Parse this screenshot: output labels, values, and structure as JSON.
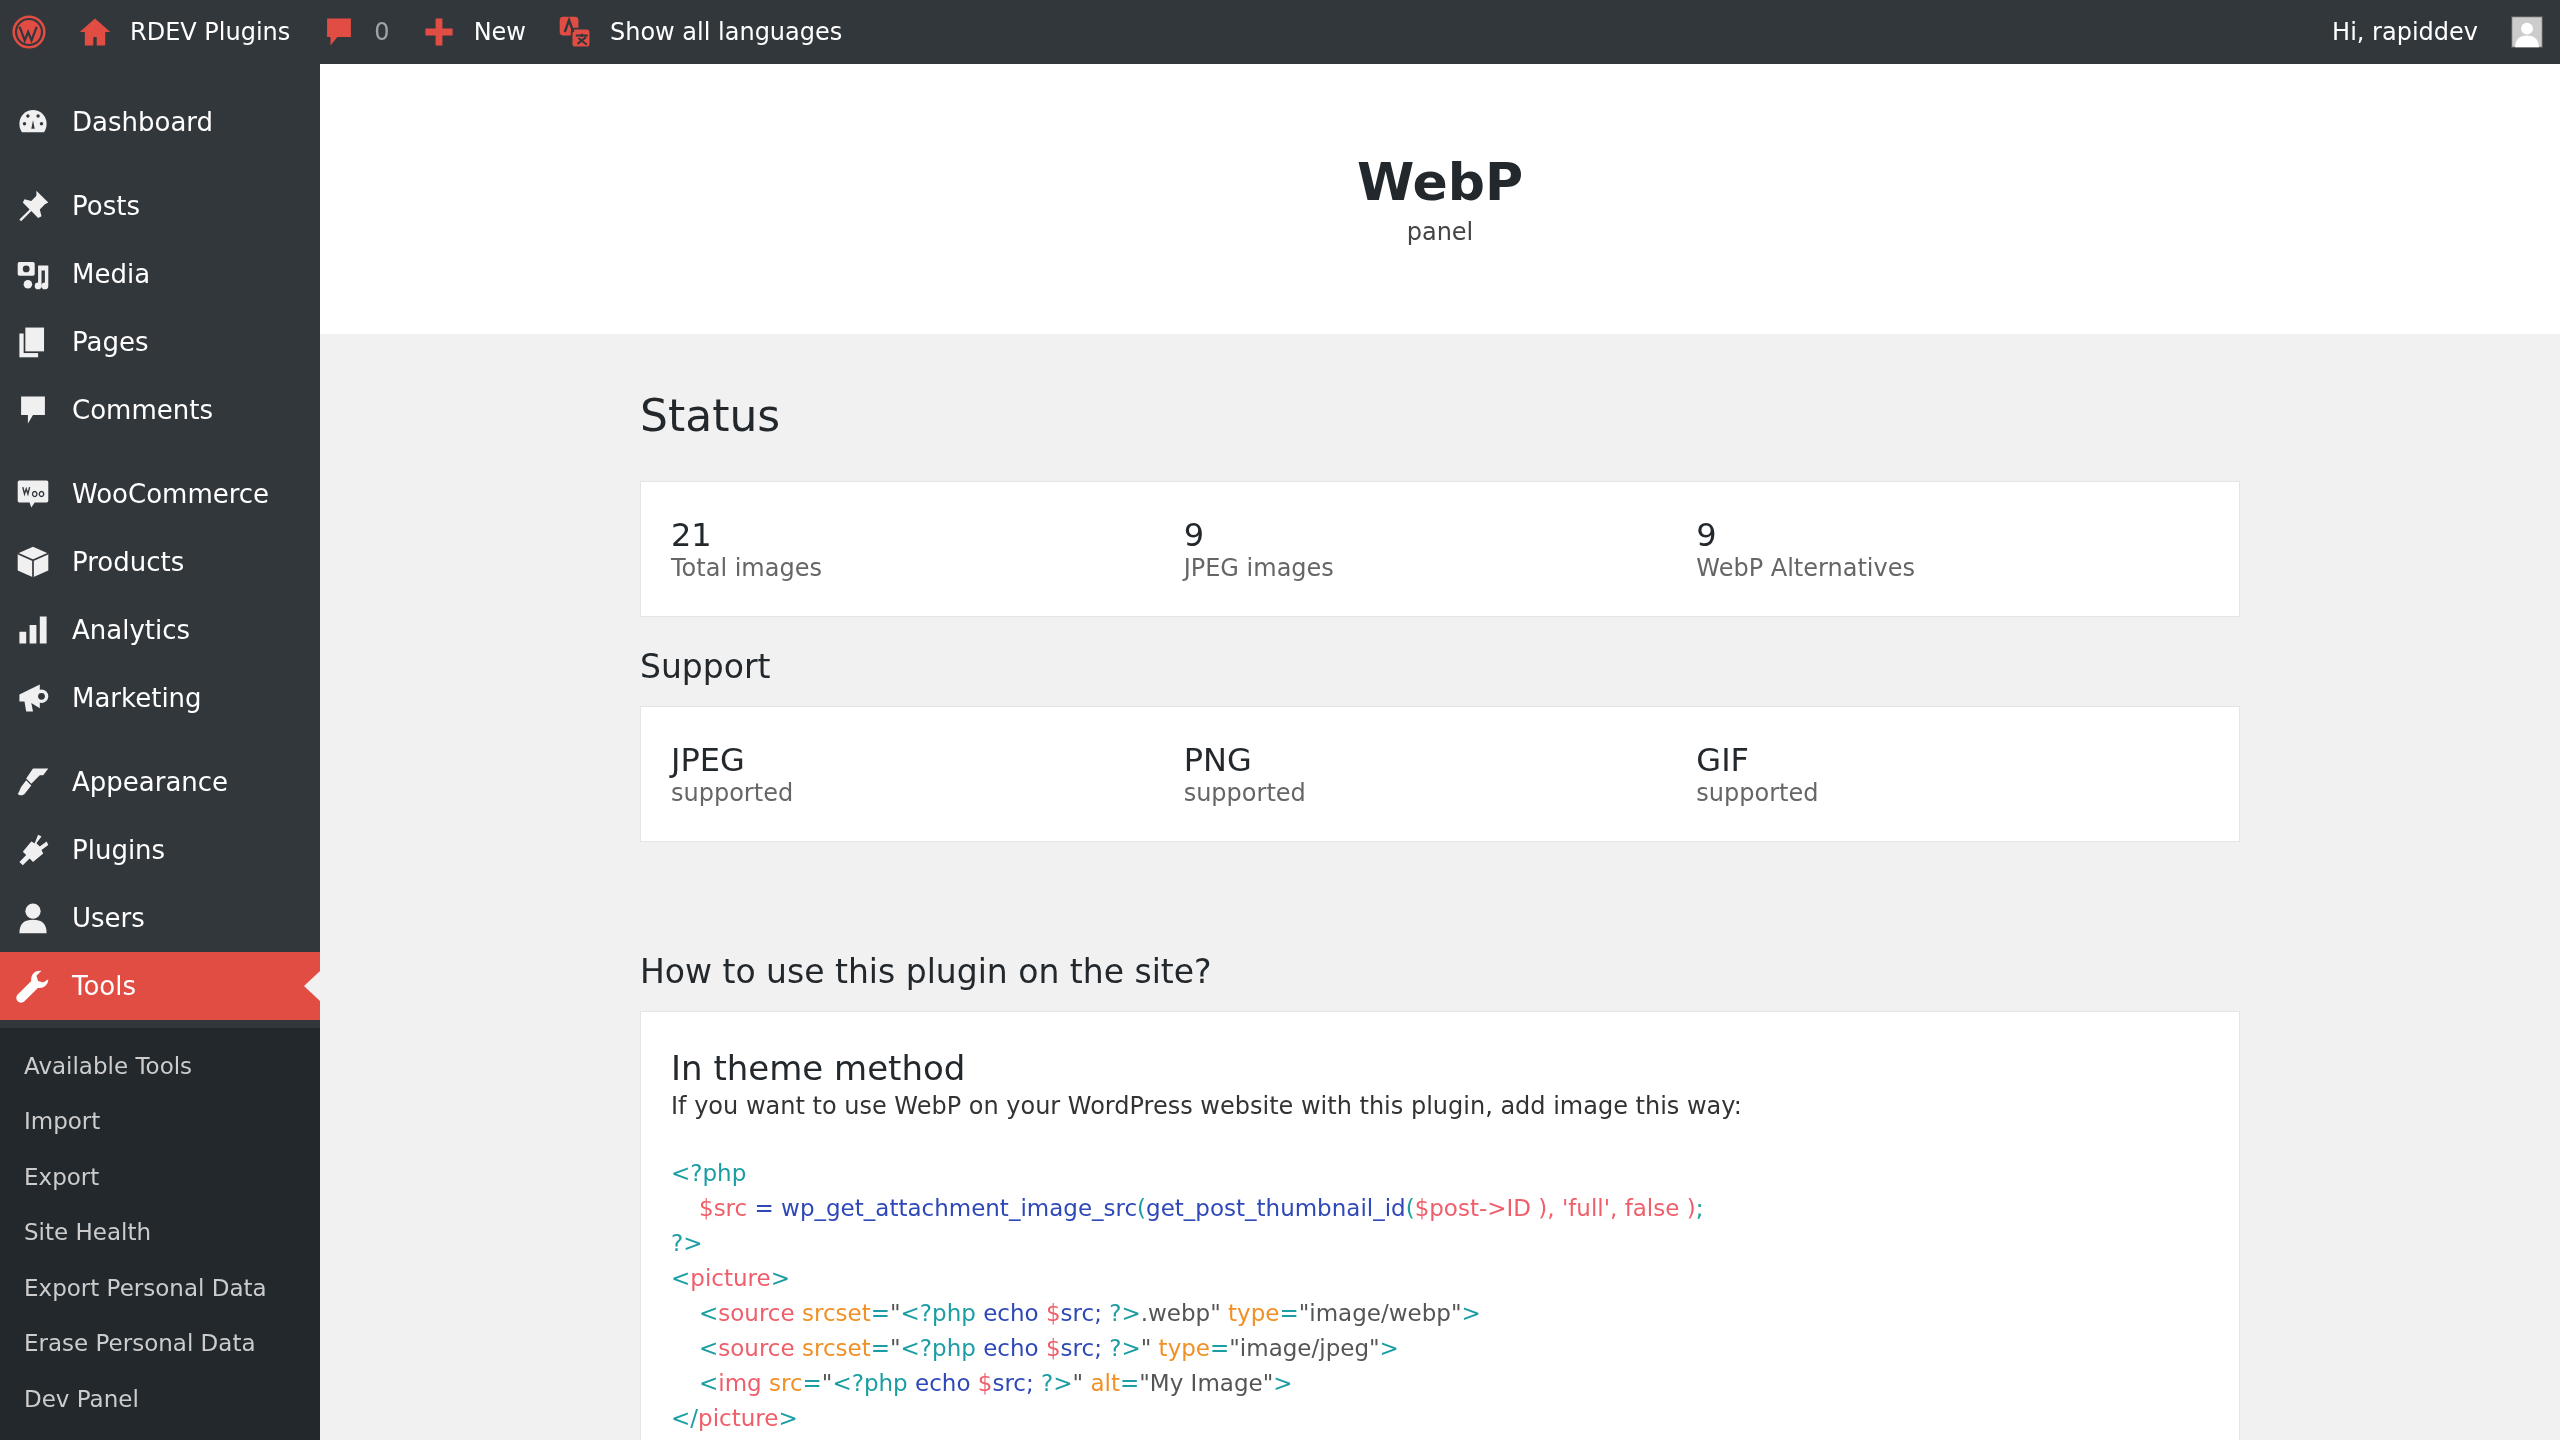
{
  "admin_bar": {
    "items": [
      {
        "label": "RDEV Plugins",
        "muted": false
      },
      {
        "label": "0",
        "muted": true
      },
      {
        "label": "New",
        "muted": false
      },
      {
        "label": "Show all languages",
        "muted": false
      }
    ],
    "greeting": "Hi, rapiddev"
  },
  "sidebar": {
    "groups": [
      [
        {
          "label": "Dashboard",
          "selected": false
        }
      ],
      [
        {
          "label": "Posts",
          "selected": false
        },
        {
          "label": "Media",
          "selected": false
        },
        {
          "label": "Pages",
          "selected": false
        },
        {
          "label": "Comments",
          "selected": false
        }
      ],
      [
        {
          "label": "WooCommerce",
          "selected": false
        },
        {
          "label": "Products",
          "selected": false
        },
        {
          "label": "Analytics",
          "selected": false
        },
        {
          "label": "Marketing",
          "selected": false
        }
      ],
      [
        {
          "label": "Appearance",
          "selected": false
        },
        {
          "label": "Plugins",
          "selected": false
        },
        {
          "label": "Users",
          "selected": false
        },
        {
          "label": "Tools",
          "selected": true
        }
      ]
    ],
    "submenu": [
      {
        "label": "Available Tools",
        "selected": false
      },
      {
        "label": "Import",
        "selected": false
      },
      {
        "label": "Export",
        "selected": false
      },
      {
        "label": "Site Health",
        "selected": false
      },
      {
        "label": "Export Personal Data",
        "selected": false
      },
      {
        "label": "Erase Personal Data",
        "selected": false
      },
      {
        "label": "Dev Panel",
        "selected": false
      }
    ]
  },
  "header": {
    "title": "WebP",
    "subtitle": "panel"
  },
  "status": {
    "heading": "Status",
    "stats": [
      {
        "value": "21",
        "label": "Total images"
      },
      {
        "value": "9",
        "label": "JPEG images"
      },
      {
        "value": "9",
        "label": "WebP Alternatives"
      }
    ]
  },
  "support": {
    "heading": "Support",
    "formats": [
      {
        "name": "JPEG",
        "status": "supported"
      },
      {
        "name": "PNG",
        "status": "supported"
      },
      {
        "name": "GIF",
        "status": "supported"
      }
    ]
  },
  "usage": {
    "heading": "How to use this plugin on the site?",
    "method_title": "In theme method",
    "description": "If you want to use WebP on your WordPress website with this plugin, add image this way:",
    "code_lines": [
      {
        "indented": false,
        "tokens": [
          {
            "text": "<?php",
            "kind": "punct"
          }
        ]
      },
      {
        "indented": true,
        "tokens": [
          {
            "text": "$src",
            "kind": "var"
          },
          {
            "text": " = wp_get_attachment_image_src",
            "kind": "func"
          },
          {
            "text": "(",
            "kind": "punct"
          },
          {
            "text": "get_post_thumbnail_id",
            "kind": "func"
          },
          {
            "text": "(",
            "kind": "punct"
          },
          {
            "text": "$post->ID ), 'full', false )",
            "kind": "var"
          },
          {
            "text": ";",
            "kind": "punct"
          }
        ]
      },
      {
        "indented": false,
        "tokens": [
          {
            "text": "?>",
            "kind": "punct"
          }
        ]
      },
      {
        "indented": false,
        "tokens": [
          {
            "text": "<",
            "kind": "punct"
          },
          {
            "text": "picture",
            "kind": "tag"
          },
          {
            "text": ">",
            "kind": "punct"
          }
        ]
      },
      {
        "indented": true,
        "tokens": [
          {
            "text": "<",
            "kind": "punct"
          },
          {
            "text": "source",
            "kind": "tag"
          },
          {
            "text": " srcset",
            "kind": "attr"
          },
          {
            "text": "=",
            "kind": "punct"
          },
          {
            "text": "\"",
            "kind": "str"
          },
          {
            "text": "<?php",
            "kind": "punct"
          },
          {
            "text": " echo ",
            "kind": "func"
          },
          {
            "text": "$",
            "kind": "var"
          },
          {
            "text": "src; ",
            "kind": "func"
          },
          {
            "text": "?>",
            "kind": "punct"
          },
          {
            "text": ".webp\"",
            "kind": "str"
          },
          {
            "text": " type",
            "kind": "attr"
          },
          {
            "text": "=",
            "kind": "punct"
          },
          {
            "text": "\"image/webp\"",
            "kind": "str"
          },
          {
            "text": ">",
            "kind": "punct"
          }
        ]
      },
      {
        "indented": true,
        "tokens": [
          {
            "text": "<",
            "kind": "punct"
          },
          {
            "text": "source",
            "kind": "tag"
          },
          {
            "text": " srcset",
            "kind": "attr"
          },
          {
            "text": "=",
            "kind": "punct"
          },
          {
            "text": "\"",
            "kind": "str"
          },
          {
            "text": "<?php",
            "kind": "punct"
          },
          {
            "text": " echo ",
            "kind": "func"
          },
          {
            "text": "$",
            "kind": "var"
          },
          {
            "text": "src; ",
            "kind": "func"
          },
          {
            "text": "?>",
            "kind": "punct"
          },
          {
            "text": "\"",
            "kind": "str"
          },
          {
            "text": " type",
            "kind": "attr"
          },
          {
            "text": "=",
            "kind": "punct"
          },
          {
            "text": "\"image/jpeg\"",
            "kind": "str"
          },
          {
            "text": ">",
            "kind": "punct"
          }
        ]
      },
      {
        "indented": true,
        "tokens": [
          {
            "text": "<",
            "kind": "punct"
          },
          {
            "text": "img",
            "kind": "tag"
          },
          {
            "text": " src",
            "kind": "attr"
          },
          {
            "text": "=",
            "kind": "punct"
          },
          {
            "text": "\"",
            "kind": "str"
          },
          {
            "text": "<?php",
            "kind": "punct"
          },
          {
            "text": " echo ",
            "kind": "func"
          },
          {
            "text": "$",
            "kind": "var"
          },
          {
            "text": "src; ",
            "kind": "func"
          },
          {
            "text": "?>",
            "kind": "punct"
          },
          {
            "text": "\"",
            "kind": "str"
          },
          {
            "text": " alt",
            "kind": "attr"
          },
          {
            "text": "=",
            "kind": "punct"
          },
          {
            "text": "\"My Image\"",
            "kind": "str"
          },
          {
            "text": ">",
            "kind": "punct"
          }
        ]
      },
      {
        "indented": false,
        "tokens": [
          {
            "text": "</",
            "kind": "punct"
          },
          {
            "text": "picture",
            "kind": "tag"
          },
          {
            "text": ">",
            "kind": "punct"
          }
        ]
      }
    ]
  }
}
